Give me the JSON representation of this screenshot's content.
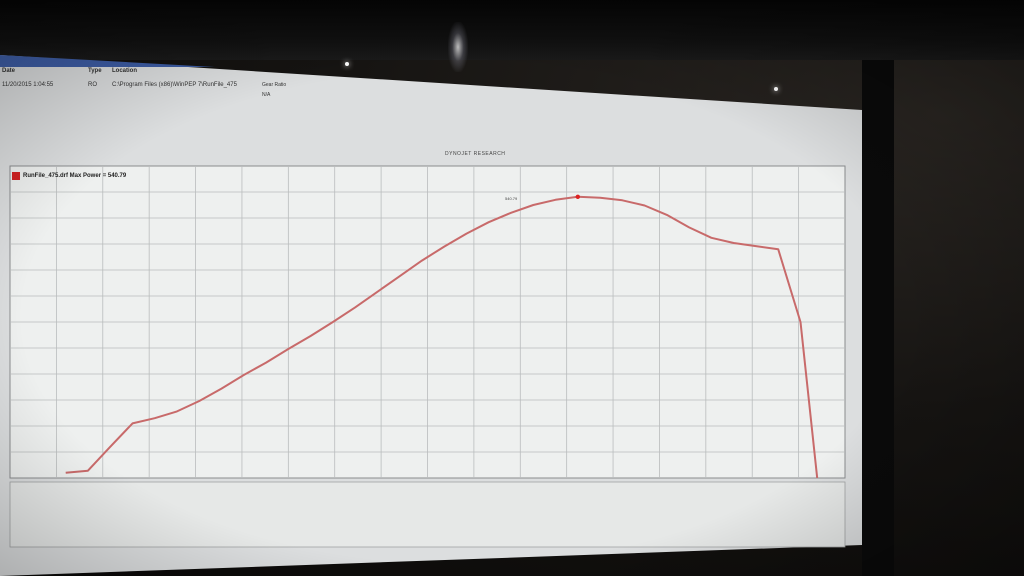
{
  "window": {
    "title_color": "#2c4a8f"
  },
  "run_table": {
    "headers": [
      "Date",
      "Type",
      "Location"
    ],
    "row": [
      "11/20/2015 1:04:55",
      "RO",
      "C:\\Program Files (x86)\\WinPEP 7\\RunFile_475"
    ],
    "gear_ratio_header": "Gear Ratio",
    "gear_ratio_value": "N/A"
  },
  "chart_heading": "DYNOJET RESEARCH",
  "legend": {
    "swatch_color": "#d22222",
    "label": "RunFile_475.drf Max Power = 540.79"
  },
  "peak_label": "540.79",
  "chart_data": {
    "type": "line",
    "title": "",
    "xlabel": "",
    "ylabel": "",
    "grid": true,
    "legend_position": "top-left",
    "series": [
      {
        "name": "RunFile_475.drf Max Power = 540.79",
        "color": "#c86a6a",
        "x": [
          0,
          2,
          4,
          6,
          8,
          10,
          12,
          14,
          16,
          18,
          20,
          22,
          24,
          26,
          28,
          30,
          32,
          34,
          36,
          38,
          40,
          42,
          44,
          46,
          48,
          50,
          52,
          54,
          56,
          58,
          60,
          62,
          64,
          66,
          67.5
        ],
        "y": [
          10,
          14,
          60,
          105,
          115,
          128,
          148,
          172,
          198,
          222,
          248,
          273,
          300,
          328,
          358,
          388,
          418,
          445,
          470,
          492,
          510,
          525,
          535,
          540.79,
          539,
          534,
          524,
          506,
          482,
          462,
          452,
          446,
          440,
          300,
          0
        ]
      }
    ],
    "xlim": [
      -5,
      70
    ],
    "ylim": [
      0,
      600
    ],
    "peak": {
      "x": 46,
      "y": 540.79
    }
  }
}
